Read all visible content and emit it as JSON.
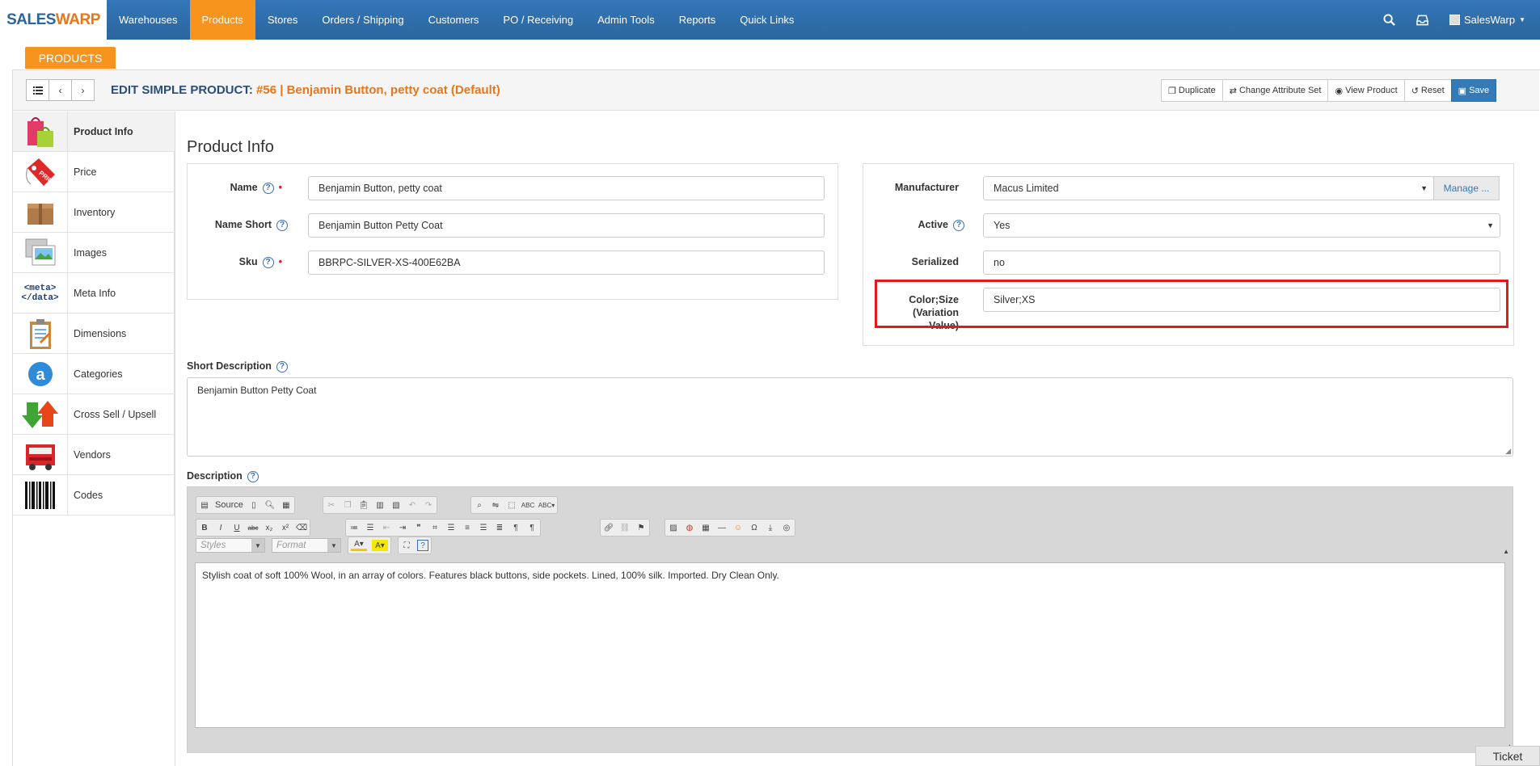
{
  "brand": {
    "part1": "SALES",
    "part2": "WARP"
  },
  "nav": {
    "items": [
      "Warehouses",
      "Products",
      "Stores",
      "Orders / Shipping",
      "Customers",
      "PO / Receiving",
      "Admin Tools",
      "Reports",
      "Quick Links"
    ],
    "active": "Products",
    "user": "SalesWarp"
  },
  "section_tab": "PRODUCTS",
  "header": {
    "prefix": "EDIT SIMPLE PRODUCT:",
    "product": "#56 | Benjamin Button, petty coat (Default)",
    "buttons": {
      "duplicate": "Duplicate",
      "change_attr": "Change Attribute Set",
      "view": "View Product",
      "reset": "Reset",
      "save": "Save"
    }
  },
  "sidebar": {
    "items": [
      {
        "label": "Product Info",
        "icon": "shopping-bags-icon"
      },
      {
        "label": "Price",
        "icon": "price-tag-icon"
      },
      {
        "label": "Inventory",
        "icon": "box-icon"
      },
      {
        "label": "Images",
        "icon": "picture-icon"
      },
      {
        "label": "Meta Info",
        "icon": "meta-data-icon"
      },
      {
        "label": "Dimensions",
        "icon": "clipboard-icon"
      },
      {
        "label": "Categories",
        "icon": "categories-icon"
      },
      {
        "label": "Cross Sell / Upsell",
        "icon": "arrows-icon"
      },
      {
        "label": "Vendors",
        "icon": "truck-icon"
      },
      {
        "label": "Codes",
        "icon": "barcode-icon"
      }
    ],
    "meta_icon_text": [
      "<meta>",
      "</data>"
    ]
  },
  "main": {
    "title": "Product Info",
    "fields_left": {
      "name_label": "Name",
      "name_value": "Benjamin Button, petty coat",
      "short_label": "Name Short",
      "short_value": "Benjamin Button Petty Coat",
      "sku_label": "Sku",
      "sku_value": "BBRPC-SILVER-XS-400E62BA"
    },
    "fields_right": {
      "manufacturer_label": "Manufacturer",
      "manufacturer_value": "Macus Limited",
      "manage_label": "Manage ...",
      "active_label": "Active",
      "active_value": "Yes",
      "serialized_label": "Serialized",
      "serialized_value": "no",
      "variation_label_1": "Color;Size",
      "variation_label_2": "(Variation Value)",
      "variation_value": "Silver;XS"
    },
    "short_description": {
      "label": "Short Description",
      "value": "Benjamin Button Petty Coat"
    },
    "description": {
      "label": "Description",
      "value": "Stylish coat of soft 100% Wool, in an array of colors. Features black buttons, side pockets. Lined, 100% silk. Imported. Dry Clean Only."
    },
    "editor": {
      "source_label": "Source",
      "styles_placeholder": "Styles",
      "format_placeholder": "Format"
    }
  },
  "ticket": "Ticket",
  "colors": {
    "nav": "#2d6aa6",
    "accent": "#f7941d",
    "highlight": "#e01a1a",
    "primary": "#337ab7"
  }
}
